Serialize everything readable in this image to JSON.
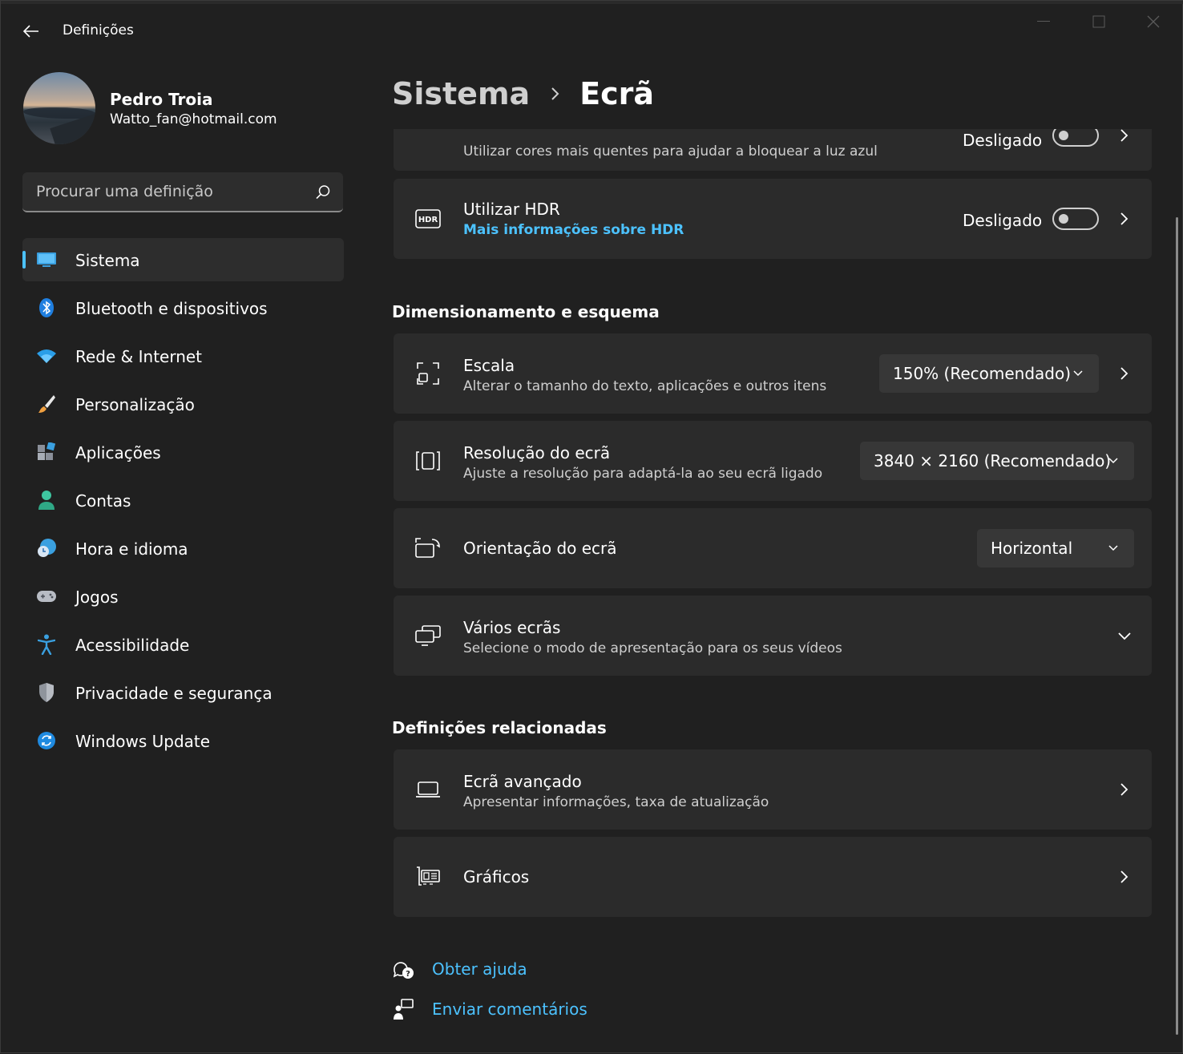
{
  "window": {
    "title": "Definições"
  },
  "profile": {
    "name": "Pedro Troia",
    "email": "Watto_fan@hotmail.com"
  },
  "search": {
    "placeholder": "Procurar uma definição"
  },
  "nav": {
    "items": [
      {
        "label": "Sistema",
        "icon": "system-icon",
        "selected": true
      },
      {
        "label": "Bluetooth e dispositivos",
        "icon": "bluetooth-icon"
      },
      {
        "label": "Rede & Internet",
        "icon": "wifi-icon"
      },
      {
        "label": "Personalização",
        "icon": "brush-icon"
      },
      {
        "label": "Aplicações",
        "icon": "apps-icon"
      },
      {
        "label": "Contas",
        "icon": "person-icon"
      },
      {
        "label": "Hora e idioma",
        "icon": "globe-clock-icon"
      },
      {
        "label": "Jogos",
        "icon": "gamepad-icon"
      },
      {
        "label": "Acessibilidade",
        "icon": "accessibility-icon"
      },
      {
        "label": "Privacidade e segurança",
        "icon": "shield-icon"
      },
      {
        "label": "Windows Update",
        "icon": "update-icon"
      }
    ]
  },
  "breadcrumb": {
    "parent": "Sistema",
    "current": "Ecrã"
  },
  "cards": {
    "night_light": {
      "subtitle": "Utilizar cores mais quentes para ajudar a bloquear a luz azul",
      "state": "Desligado"
    },
    "hdr": {
      "title": "Utilizar HDR",
      "link": "Mais informações sobre HDR",
      "state": "Desligado"
    },
    "scale": {
      "title": "Escala",
      "subtitle": "Alterar o tamanho do texto, aplicações e outros itens",
      "value": "150% (Recomendado)"
    },
    "resolution": {
      "title": "Resolução do ecrã",
      "subtitle": "Ajuste a resolução para adaptá-la ao seu ecrã ligado",
      "value": "3840 × 2160 (Recomendado)"
    },
    "orientation": {
      "title": "Orientação do ecrã",
      "value": "Horizontal"
    },
    "multiple": {
      "title": "Vários ecrãs",
      "subtitle": "Selecione o modo de apresentação para os seus vídeos"
    },
    "advanced": {
      "title": "Ecrã avançado",
      "subtitle": "Apresentar informações, taxa de atualização"
    },
    "graphics": {
      "title": "Gráficos"
    }
  },
  "sections": {
    "scale_layout": "Dimensionamento e esquema",
    "related": "Definições relacionadas"
  },
  "help": {
    "get_help": "Obter ajuda",
    "feedback": "Enviar comentários"
  },
  "colors": {
    "accent": "#4cc2ff",
    "background": "#202020",
    "card": "#2b2b2b"
  }
}
